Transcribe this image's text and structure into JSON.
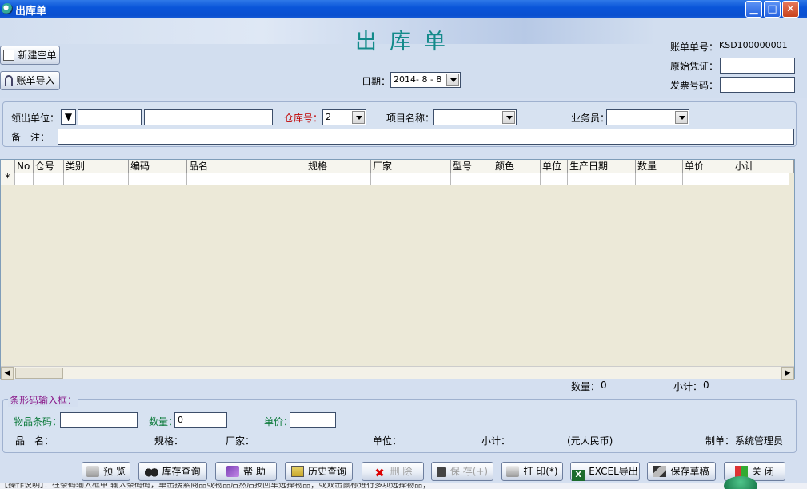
{
  "window": {
    "title": "出库单"
  },
  "header": {
    "doc_title": "出库单",
    "date_label": "日期：",
    "date_value": "2014- 8 - 8",
    "new_blank_label": "新建空单",
    "import_label": "账单导入",
    "account_no_label": "账单单号：",
    "account_no_value": "KSD100000001",
    "original_voucher_label": "原始凭证：",
    "invoice_no_label": "发票号码："
  },
  "filters": {
    "receiving_unit_label": "领出单位：",
    "warehouse_label": "仓库号：",
    "warehouse_value": "2",
    "project_label": "项目名称：",
    "salesman_label": "业务员：",
    "remark_label": "备　注："
  },
  "grid": {
    "columns": [
      "No",
      "仓号",
      "类别",
      "编码",
      "品名",
      "规格",
      "厂家",
      "型号",
      "颜色",
      "单位",
      "生产日期",
      "数量",
      "单价",
      "小计"
    ],
    "new_row_marker": "*"
  },
  "totals": {
    "qty_label": "数量：",
    "qty_value": "0",
    "subtotal_label": "小计：",
    "subtotal_value": "0"
  },
  "barcode": {
    "legend": "条形码输入框：",
    "barcode_label": "物品条码：",
    "qty_label": "数量：",
    "qty_value": "0",
    "price_label": "单价：",
    "name_label": "品　名：",
    "spec_label": "规格：",
    "maker_label": "厂家：",
    "unit_label": "单位：",
    "subtotal_label": "小计：",
    "currency_label": "(元人民币)",
    "creator_label": "制单：",
    "creator_value": "系统管理员"
  },
  "toolbar": {
    "preview": "预 览",
    "stock_query": "库存查询",
    "help": "帮 助",
    "history_query": "历史查询",
    "delete": "删 除",
    "save": "保 存(+)",
    "print": "打 印(*)",
    "excel_export": "EXCEL导出",
    "save_draft": "保存草稿",
    "close": "关 闭"
  },
  "status": {
    "text": "【操作说明】：在条码输入框中  输入条码码，单击搜索商品或物品后然后按回车选择物品；或双击鼠标进行多项选择物品；"
  }
}
